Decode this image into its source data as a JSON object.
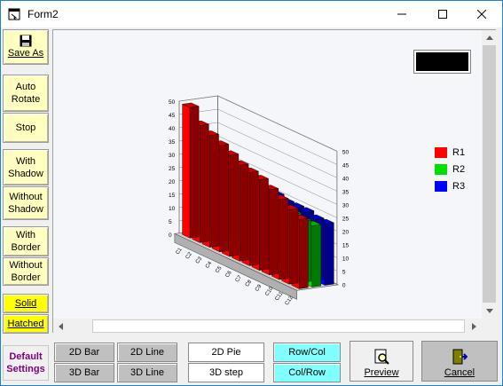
{
  "window": {
    "title": "Form2",
    "icon": "form-app-icon"
  },
  "controls": {
    "minimize": "minimize-icon",
    "maximize": "maximize-icon",
    "close": "close-icon"
  },
  "left_buttons": {
    "save_as": "Save As",
    "auto_rotate_1": "Auto",
    "auto_rotate_2": "Rotate",
    "stop": "Stop",
    "with_shadow_1": "With",
    "with_shadow_2": "Shadow",
    "without_shadow_1": "Without",
    "without_shadow_2": "Shadow",
    "with_border_1": "With",
    "with_border_2": "Border",
    "without_border_1": "Without",
    "without_border_2": "Border",
    "solid": "Solid",
    "hatched": "Hatched",
    "default_1": "Default",
    "default_2": "Settings"
  },
  "bottom_buttons": {
    "bar2d": "2D Bar",
    "bar3d": "3D Bar",
    "line2d": "2D Line",
    "line3d": "3D Line",
    "pie2d": "2D Pie",
    "step3d": "3D step",
    "rowcol": "Row/Col",
    "colrow": "Col/Row",
    "preview": "Preview",
    "cancel": "Cancel"
  },
  "colors": {
    "r1": "#ff0000",
    "r2": "#00e000",
    "r3": "#0000ff",
    "button_yellow": "#ffffc0",
    "button_cyan": "#80ffff"
  },
  "chart_data": {
    "type": "bar",
    "title": "",
    "view": "3d",
    "categories": [
      "C1",
      "C2",
      "C3",
      "C4",
      "C5",
      "C6",
      "C7",
      "C8",
      "C9",
      "C10",
      "C11",
      "C12"
    ],
    "z_ticks": [
      "0",
      "5",
      "10",
      "15",
      "20",
      "25",
      "30",
      "35",
      "40",
      "45",
      "50"
    ],
    "ylim": [
      0,
      50
    ],
    "series": [
      {
        "name": "R1",
        "values": [
          49,
          44,
          42,
          40,
          38,
          36,
          35,
          34,
          32,
          30,
          28,
          26
        ]
      },
      {
        "name": "R2",
        "values": [
          38,
          30,
          27,
          26,
          26,
          25,
          25,
          24,
          24,
          24,
          23,
          23
        ]
      },
      {
        "name": "R3",
        "values": [
          33,
          28,
          26,
          26,
          26,
          25,
          25,
          24,
          24,
          24,
          23,
          23
        ]
      }
    ],
    "legend_position": "right"
  }
}
